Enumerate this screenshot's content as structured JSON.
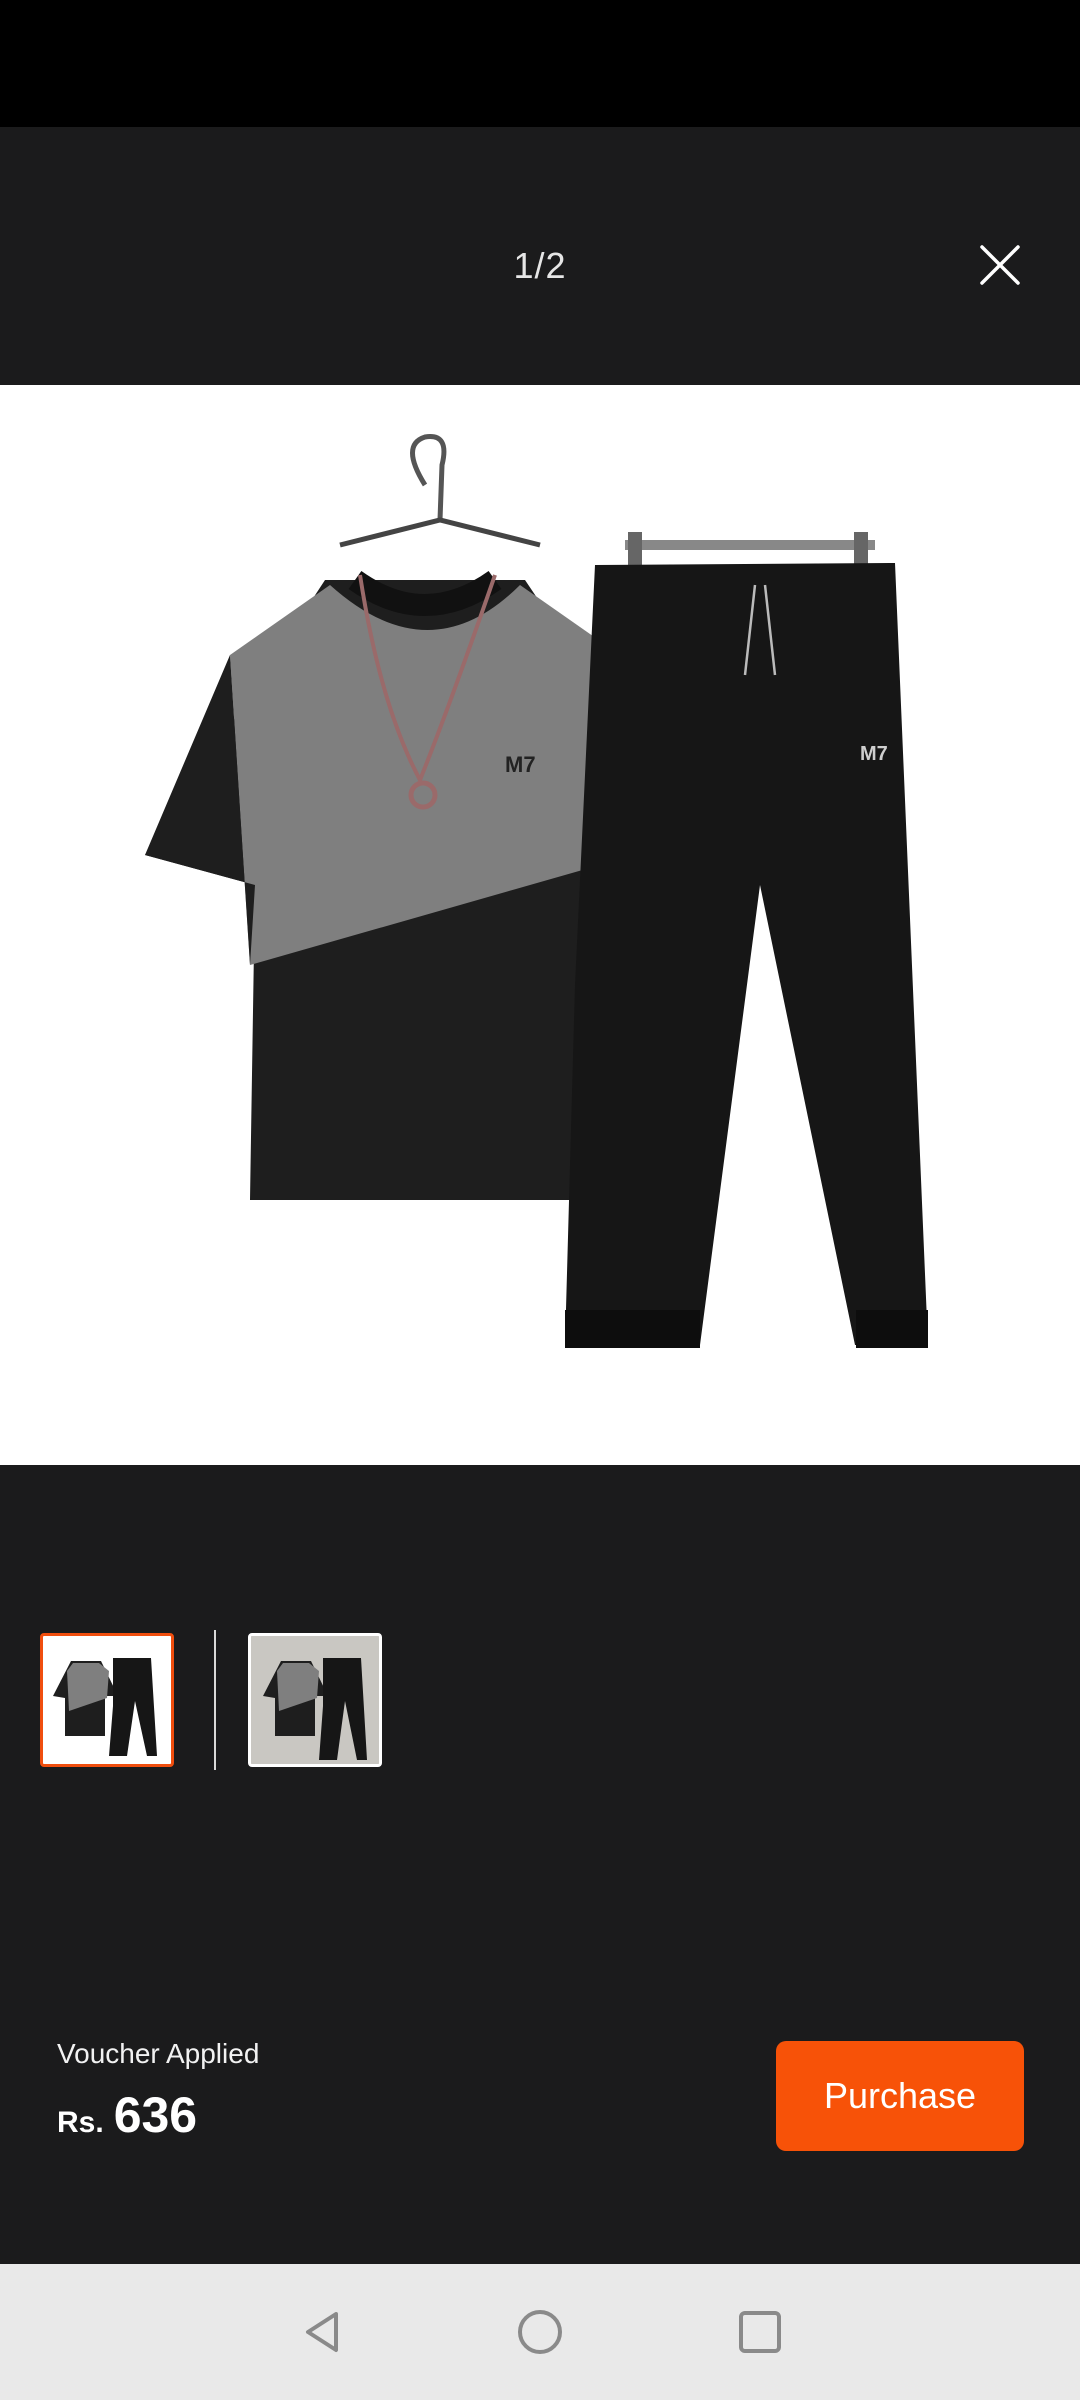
{
  "viewer": {
    "page_indicator": "1/2",
    "product_logo_text": "M7"
  },
  "footer": {
    "voucher_text": "Voucher Applied",
    "currency": "Rs.",
    "price": "636",
    "purchase_label": "Purchase"
  },
  "thumbnails": {
    "count": 2,
    "selected_index": 0
  },
  "colors": {
    "accent": "#f75208",
    "background": "#1b1b1c",
    "nav_bar": "#e9e9e9"
  },
  "icons": [
    "close-icon",
    "back-icon",
    "home-icon",
    "recents-icon"
  ]
}
